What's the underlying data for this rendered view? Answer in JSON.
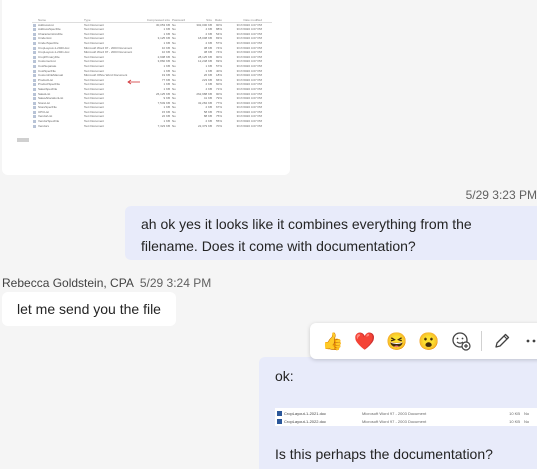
{
  "top_attachment": {
    "columns": [
      "Name",
      "Type",
      "Compressed size",
      "Password",
      "Size",
      "Ratio",
      "Date modified"
    ],
    "rows": [
      [
        "AddressList",
        "Text Document",
        "30,053 KB",
        "No",
        "302,000 KB",
        "90%",
        "3/17/2020 4:07 PM"
      ],
      [
        "AddressSpecFile",
        "Text Document",
        "1 KB",
        "No",
        "4 KB",
        "88%",
        "3/17/2020 4:07 PM"
      ],
      [
        "CharacteristicsFile",
        "Text Document",
        "1 KB",
        "No",
        "2 KB",
        "54%",
        "3/17/2020 4:07 PM"
      ],
      [
        "CinderList",
        "Text Document",
        "3,125 KB",
        "No",
        "18,008 KB",
        "83%",
        "3/17/2020 4:07 PM"
      ],
      [
        "CinderSpecFile",
        "Text Document",
        "1 KB",
        "No",
        "2 KB",
        "57%",
        "3/17/2020 4:07 PM"
      ],
      [
        "CropLayout-1-2020.doc",
        "Microsoft Word 97 - 2003 Document",
        "10 KB",
        "No",
        "38 KB",
        "74%",
        "3/17/2020 4:07 PM"
      ],
      [
        "CropLayout-1-2021.doc",
        "Microsoft Word 97 - 2003 Document",
        "10 KB",
        "No",
        "38 KB",
        "74%",
        "3/17/2020 4:07 PM"
      ],
      [
        "CropPrimaryFile",
        "Text Document",
        "2,908 KB",
        "No",
        "28,125 KB",
        "90%",
        "3/17/2020 4:07 PM"
      ],
      [
        "CustomerList",
        "Text Document",
        "3,860 KB",
        "No",
        "12,248 KB",
        "69%",
        "3/17/2020 4:07 PM"
      ],
      [
        "CustSeparate",
        "Text Document",
        "1 KB",
        "No",
        "1 KB",
        "57%",
        "3/17/2020 4:07 PM"
      ],
      [
        "CustSpecFile",
        "Text Document",
        "1 KB",
        "No",
        "1 KB",
        "40%",
        "3/17/2020 4:07 PM"
      ],
      [
        "CustomFileManual",
        "Microsoft Office Word Document",
        "19 KB",
        "No",
        "26 KB",
        "18%",
        "3/17/2020 4:07 PM"
      ],
      [
        "ProductList",
        "Text Document",
        "77 KB",
        "No",
        "223 KB",
        "66%",
        "3/17/2020 4:07 PM"
      ],
      [
        "ProductSpecFile",
        "Text Document",
        "1 KB",
        "No",
        "2 KB",
        "60%",
        "3/17/2020 4:07 PM"
      ],
      [
        "SalesSpecFile",
        "Text Document",
        "1 KB",
        "No",
        "4 KB",
        "71%",
        "3/17/2020 4:07 PM"
      ],
      [
        "SalesList",
        "Text Document",
        "26,125 KB",
        "No",
        "262,988 KB",
        "90%",
        "3/17/2020 4:07 PM"
      ],
      [
        "SalesAllocationList",
        "Text Document",
        "9 KB",
        "No",
        "41 KB",
        "79%",
        "3/17/2020 4:07 PM"
      ],
      [
        "StoreList",
        "Text Document",
        "7,549 KB",
        "No",
        "32,284 KB",
        "77%",
        "3/17/2020 4:07 PM"
      ],
      [
        "StoreSpecFile",
        "Text Document",
        "1 KB",
        "No",
        "2 KB",
        "67%",
        "3/17/2020 4:07 PM"
      ],
      [
        "UPCList",
        "Text Document",
        "15 KB",
        "No",
        "58 KB",
        "75%",
        "3/17/2020 4:07 PM"
      ],
      [
        "VendorList",
        "Text Document",
        "22 KB",
        "No",
        "88 KB",
        "75%",
        "3/17/2020 4:07 PM"
      ],
      [
        "VendorSpecFile",
        "Text Document",
        "1 KB",
        "No",
        "2 KB",
        "55%",
        "3/17/2020 4:07 PM"
      ],
      [
        "Vendors",
        "Text Document",
        "7,323 KB",
        "No",
        "22,379 KB",
        "70%",
        "3/17/2020 4:07 PM"
      ]
    ]
  },
  "messages": {
    "my_time_1": "5/29 3:23 PM",
    "my_message_1": "ah ok yes it looks like it combines everything from the filename. Does it come with documentation?",
    "sender_name": "Rebecca Goldstein, CPA",
    "sender_time": "5/29 3:24 PM",
    "their_message": "let me send you the file",
    "my_message_2_line1": "ok:",
    "my_message_2_line2": "Is this perhaps the documentation?",
    "attached_files": [
      {
        "name": "CropLayout-1-2021.doc",
        "type": "Microsoft Word 97 - 2003 Document",
        "size": "10 KB",
        "protected": "No"
      },
      {
        "name": "CropLayout-1-2022.doc",
        "type": "Microsoft Word 97 - 2003 Document",
        "size": "10 KB",
        "protected": "No"
      }
    ]
  },
  "reactions": {
    "items": [
      "👍",
      "❤️",
      "😆",
      "😮",
      "😢"
    ],
    "icons": [
      "like-icon",
      "heart-icon",
      "laugh-icon",
      "surprised-icon",
      "sad-icon",
      "add-reaction-icon",
      "edit-icon",
      "more-options-icon"
    ]
  }
}
